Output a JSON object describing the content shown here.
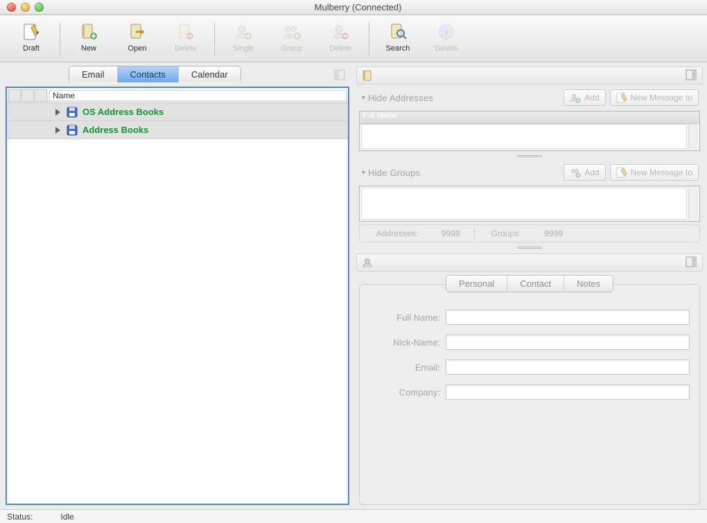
{
  "window": {
    "title": "Mulberry (Connected)"
  },
  "toolbar": {
    "draft": "Draft",
    "new": "New",
    "open": "Open",
    "delete_book": "Delete",
    "single": "Single",
    "group": "Group",
    "delete_contact": "Delete",
    "search": "Search",
    "details": "Details"
  },
  "main_tabs": {
    "email": "Email",
    "contacts": "Contacts",
    "calendar": "Calendar"
  },
  "tree": {
    "header": "Name",
    "items": [
      {
        "label": "OS Address Books"
      },
      {
        "label": "Address Books"
      }
    ]
  },
  "addresses_section": {
    "toggle": "Hide Addresses",
    "add": "Add",
    "new_msg": "New Message to",
    "column_header": "Full Name"
  },
  "groups_section": {
    "toggle": "Hide Groups",
    "add": "Add",
    "new_msg": "New Message to"
  },
  "counts": {
    "addresses_label": "Addresses:",
    "addresses_value": "9999",
    "groups_label": "Groups:",
    "groups_value": "9999"
  },
  "detail_tabs": {
    "personal": "Personal",
    "contact": "Contact",
    "notes": "Notes"
  },
  "fields": {
    "full_name": "Full Name:",
    "nick_name": "Nick-Name:",
    "email": "Email:",
    "company": "Company:"
  },
  "status": {
    "label": "Status:",
    "value": "Idle"
  }
}
